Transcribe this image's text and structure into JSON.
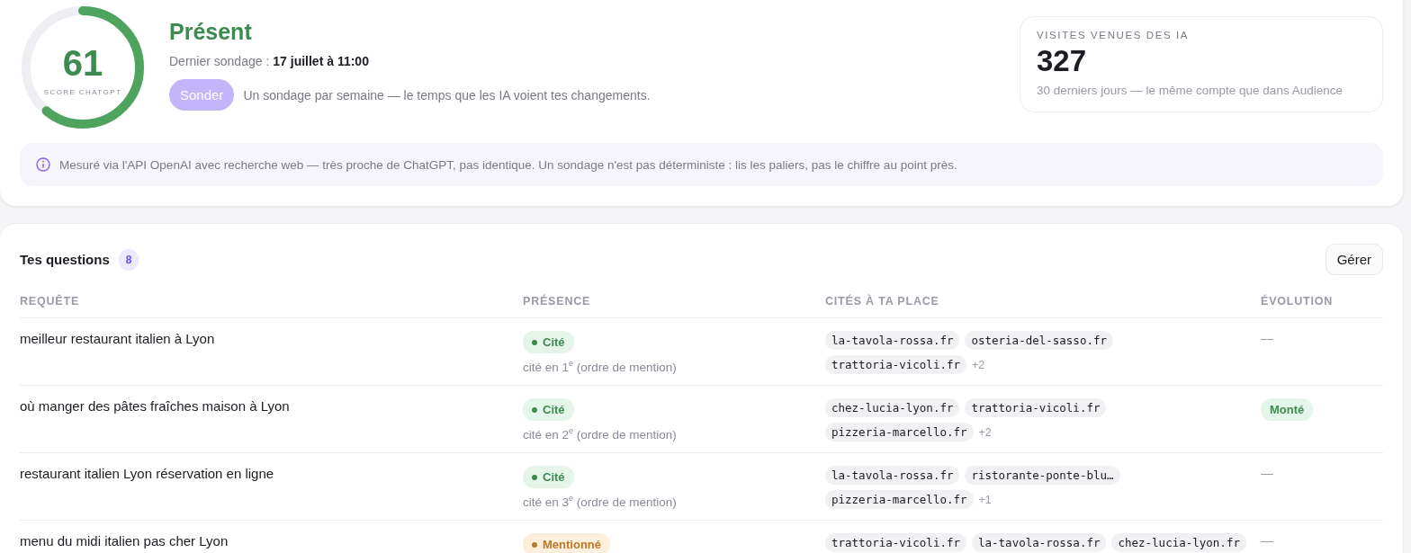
{
  "score": {
    "value": "61",
    "label": "SCORE CHATGPT",
    "level": 0.61
  },
  "status": {
    "title": "Présent",
    "last_label": "Dernier sondage :",
    "last_value": "17 juillet à 11:00"
  },
  "probe": {
    "button": "Sonder",
    "note": "Un sondage par semaine — le temps que les IA voient tes changements."
  },
  "stat": {
    "label": "VISITES VENUES DES IA",
    "value": "327",
    "caption": "30 derniers jours — le même compte que dans Audience"
  },
  "info": "Mesuré via l'API OpenAI avec recherche web — très proche de ChatGPT, pas identique. Un sondage n'est pas déterministe : lis les paliers, pas le chiffre au point près.",
  "questions": {
    "title": "Tes questions",
    "count": "8",
    "manage": "Gérer",
    "columns": [
      "REQUÊTE",
      "PRÉSENCE",
      "CITÉS À TA PLACE",
      "ÉVOLUTION"
    ],
    "rows": [
      {
        "query": "meilleur restaurant italien à Lyon",
        "presence": {
          "kind": "cited",
          "label": "Cité"
        },
        "rank": "cité en 1$^{e}$ (ordre de mention)",
        "domains": [
          "la-tavola-rossa.fr",
          "osteria-del-sasso.fr",
          "trattoria-vicoli.fr"
        ],
        "more": "+2",
        "evolution": {
          "kind": "none",
          "label": "—"
        }
      },
      {
        "query": "où manger des pâtes fraîches maison à Lyon",
        "presence": {
          "kind": "cited",
          "label": "Cité"
        },
        "rank": "cité en 2$^{e}$ (ordre de mention)",
        "domains": [
          "chez-lucia-lyon.fr",
          "trattoria-vicoli.fr",
          "pizzeria-marcello.fr"
        ],
        "more": "+2",
        "evolution": {
          "kind": "up",
          "label": "Monté"
        }
      },
      {
        "query": "restaurant italien Lyon réservation en ligne",
        "presence": {
          "kind": "cited",
          "label": "Cité"
        },
        "rank": "cité en 3$^{e}$ (ordre de mention)",
        "domains": [
          "la-tavola-rossa.fr",
          "ristorante-ponte-blu…",
          "pizzeria-marcello.fr"
        ],
        "more": "+1",
        "evolution": {
          "kind": "none",
          "label": "—"
        }
      },
      {
        "query": "menu du midi italien pas cher Lyon",
        "presence": {
          "kind": "mentioned",
          "label": "Mentionné"
        },
        "domains": [
          "trattoria-vicoli.fr",
          "la-tavola-rossa.fr",
          "chez-lucia-lyon.fr"
        ],
        "evolution": {
          "kind": "none",
          "label": "—"
        }
      }
    ]
  }
}
